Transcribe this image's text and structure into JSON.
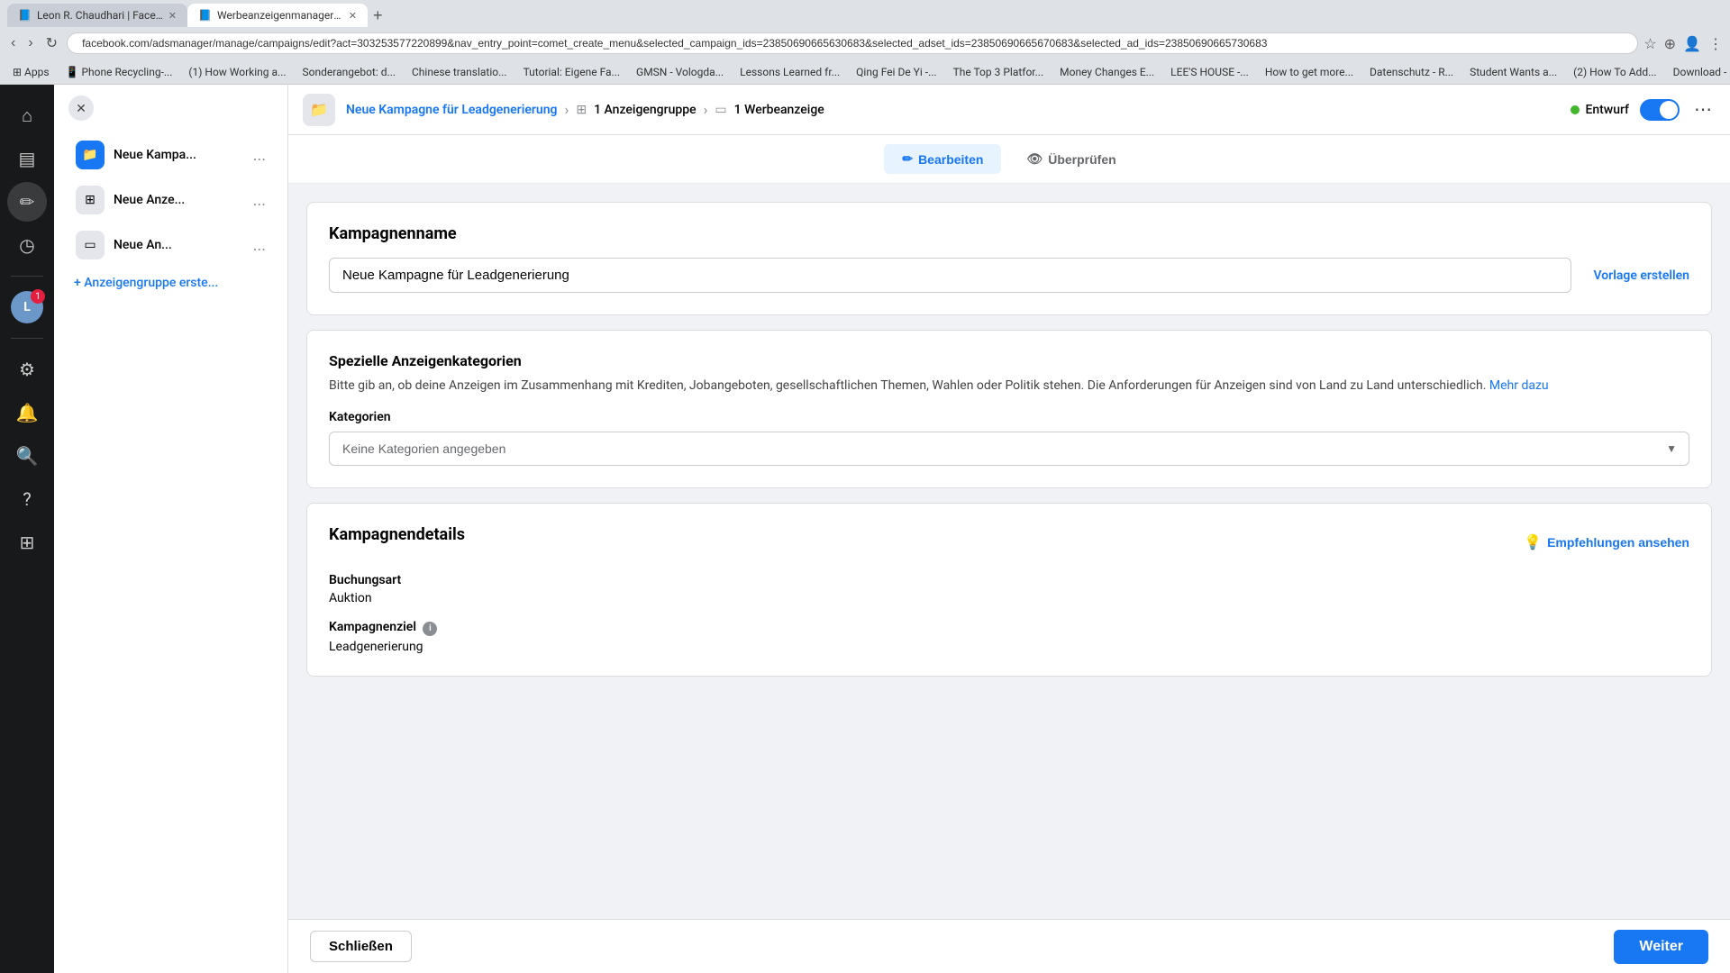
{
  "browser": {
    "tabs": [
      {
        "label": "Leon R. Chaudhari | Facebook",
        "active": false
      },
      {
        "label": "Werbeanzeigenmanager - W...",
        "active": true
      }
    ],
    "address": "facebook.com/adsmanager/manage/campaigns/edit?act=303253577220899&nav_entry_point=comet_create_menu&selected_campaign_ids=23850690665630683&selected_adset_ids=23850690665670683&selected_ad_ids=23850690665730683",
    "bookmarks": [
      "Apps",
      "Phone Recycling-...",
      "(1) How Working a...",
      "Sonderangebot: d...",
      "Chinese translatio...",
      "Tutorial: Eigene Fa...",
      "GMSN - Vologda...",
      "Lessons Learned fr...",
      "Qing Fei De Yi -...",
      "The Top 3 Platfor...",
      "Money Changes E...",
      "LEE'S HOUSE -...",
      "How to get more...",
      "Datenschutz - R...",
      "Student Wants a...",
      "(2) How To Add...",
      "Download - Cooki..."
    ]
  },
  "sidebar": {
    "icons": [
      {
        "name": "home",
        "symbol": "⌂",
        "active": false
      },
      {
        "name": "chart",
        "symbol": "▤",
        "active": false
      },
      {
        "name": "edit",
        "symbol": "✏",
        "active": true
      },
      {
        "name": "history",
        "symbol": "◷",
        "active": false
      },
      {
        "name": "avatar",
        "initials": "L",
        "active": false,
        "badge": "1"
      },
      {
        "name": "grid",
        "symbol": "⊞",
        "active": false
      }
    ]
  },
  "nav_panel": {
    "campaign_item": {
      "label": "Neue Kampa...",
      "more": "..."
    },
    "adset_item": {
      "label": "Neue Anze...",
      "more": "..."
    },
    "ad_item": {
      "label": "Neue An...",
      "more": "..."
    },
    "add_group_label": "+ Anzeigengruppe erste..."
  },
  "top_bar": {
    "campaign_breadcrumb": "Neue Kampagne für Leadgenerierung",
    "adset_breadcrumb": "1 Anzeigengruppe",
    "ad_breadcrumb": "1 Werbeanzeige",
    "status_label": "Entwurf",
    "more_label": "⋯"
  },
  "edit_tabs": {
    "bearbeiten": "Bearbeiten",
    "ueberpruefen": "Überprüfen"
  },
  "kampagnenname_section": {
    "title": "Kampagnenname",
    "input_value": "Neue Kampagne für Leadgenerierung",
    "vorlage_label": "Vorlage erstellen"
  },
  "spezielle_section": {
    "title": "Spezielle Anzeigenkategorien",
    "description": "Bitte gib an, ob deine Anzeigen im Zusammenhang mit Krediten, Jobangeboten, gesellschaftlichen Themen, Wahlen oder Politik stehen. Die Anforderungen für Anzeigen sind von Land zu Land unterschiedlich.",
    "mehr_label": "Mehr dazu",
    "kategorien_label": "Kategorien",
    "dropdown_placeholder": "Keine Kategorien angegeben"
  },
  "kampagnendetails_section": {
    "title": "Kampagnendetails",
    "empfehlungen_label": "Empfehlungen ansehen",
    "buchungsart_label": "Buchungsart",
    "buchungsart_value": "Auktion",
    "kampagnenziel_label": "Kampagnenziel",
    "kampagnenziel_value": "Leadgenerierung"
  },
  "bottom_bar": {
    "schliessen_label": "Schließen",
    "weiter_label": "Weiter"
  },
  "colors": {
    "primary": "#1877f2",
    "green": "#42b72a",
    "dark_bg": "#18191a",
    "light_bg": "#f0f2f5",
    "border": "#ddd",
    "text_primary": "#050505",
    "text_secondary": "#65676b"
  }
}
